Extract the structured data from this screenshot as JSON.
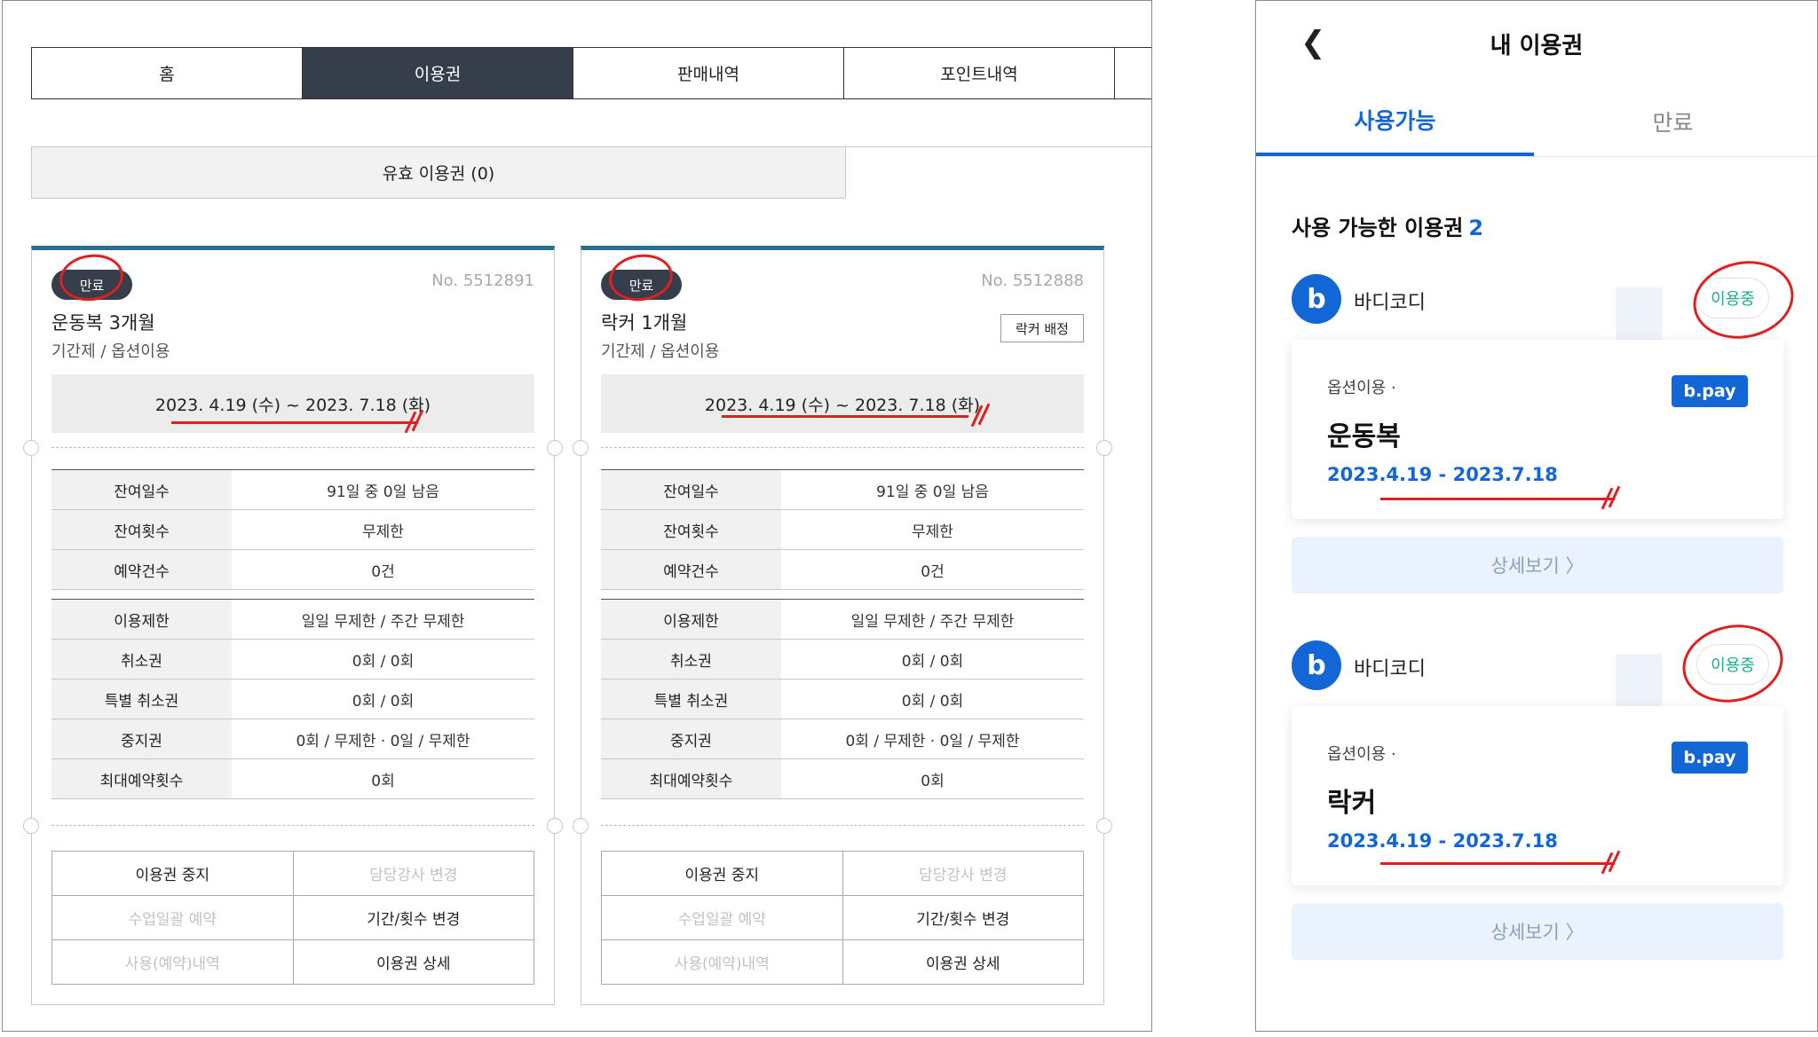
{
  "admin": {
    "tabs": [
      {
        "label": "홈"
      },
      {
        "label": "이용권"
      },
      {
        "label": "판매내역"
      },
      {
        "label": "포인트내역"
      },
      {
        "label": ""
      }
    ],
    "valid_label": "유효 이용권 (0)",
    "tickets": [
      {
        "badge": "만료",
        "no": "No. 5512891",
        "name": "운동복 3개월",
        "sub": "기간제 / 옵션이용",
        "assign": "",
        "period": "2023. 4.19 (수) ~ 2023. 7.18 (화)",
        "info1": [
          {
            "k": "잔여일수",
            "v": "91일 중 0일 남음"
          },
          {
            "k": "잔여횟수",
            "v": "무제한"
          },
          {
            "k": "예약건수",
            "v": "0건"
          }
        ],
        "info2": [
          {
            "k": "이용제한",
            "v": "일일 무제한 / 주간 무제한"
          },
          {
            "k": "취소권",
            "v": "0회 / 0회"
          },
          {
            "k": "특별 취소권",
            "v": "0회 / 0회"
          },
          {
            "k": "중지권",
            "v": "0회 / 무제한 · 0일 / 무제한"
          },
          {
            "k": "최대예약횟수",
            "v": "0회"
          }
        ],
        "actions": [
          [
            "이용권 중지",
            "담당강사 변경"
          ],
          [
            "수업일괄 예약",
            "기간/횟수 변경"
          ],
          [
            "사용(예약)내역",
            "이용권 상세"
          ]
        ]
      },
      {
        "badge": "만료",
        "no": "No. 5512888",
        "name": "락커 1개월",
        "sub": "기간제 / 옵션이용",
        "assign": "락커 배정",
        "period": "2023. 4.19 (수) ~ 2023. 7.18 (화)",
        "info1": [
          {
            "k": "잔여일수",
            "v": "91일 중 0일 남음"
          },
          {
            "k": "잔여횟수",
            "v": "무제한"
          },
          {
            "k": "예약건수",
            "v": "0건"
          }
        ],
        "info2": [
          {
            "k": "이용제한",
            "v": "일일 무제한 / 주간 무제한"
          },
          {
            "k": "취소권",
            "v": "0회 / 0회"
          },
          {
            "k": "특별 취소권",
            "v": "0회 / 0회"
          },
          {
            "k": "중지권",
            "v": "0회 / 무제한 · 0일 / 무제한"
          },
          {
            "k": "최대예약횟수",
            "v": "0회"
          }
        ],
        "actions": [
          [
            "이용권 중지",
            "담당강사 변경"
          ],
          [
            "수업일괄 예약",
            "기간/횟수 변경"
          ],
          [
            "사용(예약)내역",
            "이용권 상세"
          ]
        ]
      }
    ]
  },
  "mobile": {
    "back_icon": "chevron-left-icon",
    "title": "내 이용권",
    "tabs": [
      {
        "label": "사용가능"
      },
      {
        "label": "만료"
      }
    ],
    "count_label": "사용 가능한 이용권",
    "count": "2",
    "accent_color": "#1366d6",
    "tickets": [
      {
        "logo": "b",
        "brand": "바디코디",
        "status": "이용중",
        "option": "옵션이용 ·",
        "pay": "b.pay",
        "name": "운동복",
        "dates": "2023.4.19 - 2023.7.18",
        "detail": "상세보기 〉"
      },
      {
        "logo": "b",
        "brand": "바디코디",
        "status": "이용중",
        "option": "옵션이용 ·",
        "pay": "b.pay",
        "name": "락커",
        "dates": "2023.4.19 - 2023.7.18",
        "detail": "상세보기 〉"
      }
    ]
  }
}
